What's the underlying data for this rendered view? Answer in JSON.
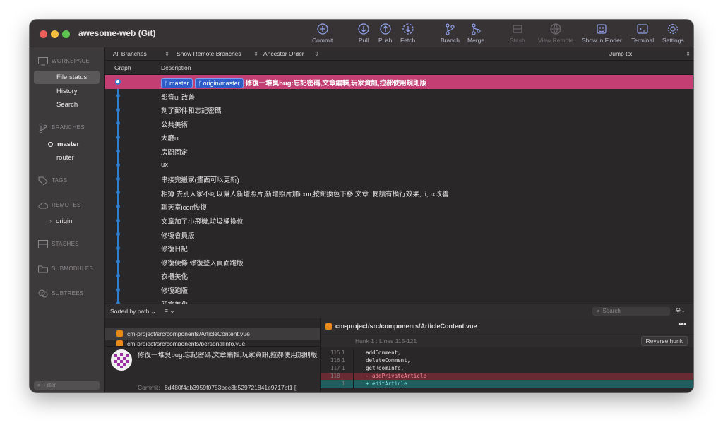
{
  "window": {
    "title": "awesome-web (Git)",
    "colors": {
      "close": "#ec5f5a",
      "minimize": "#f5be3f",
      "maximize": "#5fc551",
      "accent_selection": "#c23e73",
      "branch_badge": "#2f5dc7",
      "graph_line": "#2e7fd0"
    }
  },
  "toolbar": {
    "commit": "Commit",
    "pull": "Pull",
    "push": "Push",
    "fetch": "Fetch",
    "branch": "Branch",
    "merge": "Merge",
    "stash": "Stash",
    "view_remote": "View Remote",
    "show_in_finder": "Show in Finder",
    "terminal": "Terminal",
    "settings": "Settings"
  },
  "sidebar": {
    "workspace": "WORKSPACE",
    "file_status": "File status",
    "history": "History",
    "search": "Search",
    "branches": "BRANCHES",
    "branch_master": "master",
    "branch_router": "router",
    "tags": "TAGS",
    "remotes": "REMOTES",
    "remote_origin": "origin",
    "stashes": "STASHES",
    "submodules": "SUBMODULES",
    "subtrees": "SUBTREES",
    "filter_placeholder": "Filter"
  },
  "filters": {
    "branches": "All Branches",
    "remote": "Show Remote Branches",
    "order": "Ancestor Order",
    "jump": "Jump to:"
  },
  "columns": {
    "graph": "Graph",
    "description": "Description"
  },
  "commits": [
    {
      "badges": [
        "master",
        "origin/master"
      ],
      "desc": "修復一堆臭bug:忘記密碼,文章編輯,玩家資訊,拉郝使用規則版"
    },
    {
      "desc": "影音ui 改善"
    },
    {
      "desc": "刻了郵件和忘記密碼"
    },
    {
      "desc": "公共美術"
    },
    {
      "desc": "大廳ui"
    },
    {
      "desc": "房間固定"
    },
    {
      "desc": "ux"
    },
    {
      "desc": "串接完搬家(畫面可以更新)"
    },
    {
      "desc": "相簿:去別人家不可以幫人新增照片,新增照片加icon,按鈕換色下移 文章: 閱讀有換行效果,ui,ux改善"
    },
    {
      "desc": "聊天室icon恢復"
    },
    {
      "desc": "文章加了小飛機,垃圾桶換位"
    },
    {
      "desc": "修復會員版"
    },
    {
      "desc": "修復日記"
    },
    {
      "desc": "修復便條,修復登入頁面跑版"
    },
    {
      "desc": "衣櫃美化"
    },
    {
      "desc": "修復跑版"
    },
    {
      "desc": "留言美化"
    }
  ],
  "lower_bar": {
    "sort": "Sorted by path",
    "search_placeholder": "Search"
  },
  "files": [
    "cm-project/src/components/ArticleContent.vue",
    "cm-project/src/components/personalInfo.vue"
  ],
  "commit_detail": {
    "message": "修復一堆臭bug:忘記密碼,文章編輯,玩家資訊,拉郝使用規則版",
    "commit_label": "Commit:",
    "hash": "8d480f4ab3959f0753bec3b529721841e9717bf1 ["
  },
  "diff": {
    "file": "cm-project/src/components/ArticleContent.vue",
    "hunk": "Hunk 1 : Lines 115-121",
    "reverse": "Reverse hunk",
    "lines": [
      {
        "old": "115",
        "new": "1",
        "text": "    addComment,",
        "kind": "ctx"
      },
      {
        "old": "116",
        "new": "1",
        "text": "    deleteComment,",
        "kind": "ctx"
      },
      {
        "old": "117",
        "new": "1",
        "text": "    getRoomInfo,",
        "kind": "ctx"
      },
      {
        "old": "118",
        "new": "",
        "text": "-   addPrivateArticle",
        "kind": "del"
      },
      {
        "old": "",
        "new": "1",
        "text": "+   editArticle",
        "kind": "add"
      }
    ]
  }
}
